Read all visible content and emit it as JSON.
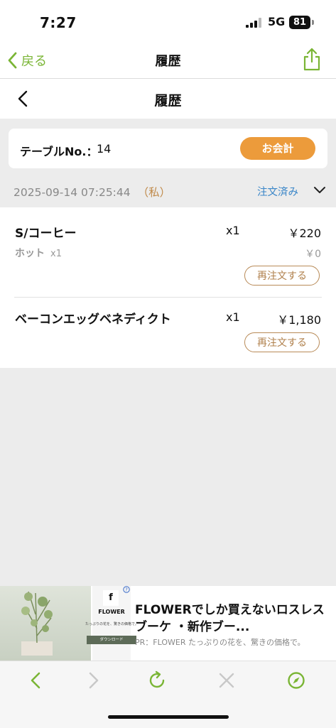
{
  "status_bar": {
    "time": "7:27",
    "network": "5G",
    "battery": "81"
  },
  "browser_nav": {
    "back_label": "戻る",
    "title": "履歴"
  },
  "page_header": {
    "title": "履歴"
  },
  "table_info": {
    "label": "テーブルNo.：",
    "number": "14",
    "pay_button": "お会計"
  },
  "order": {
    "datetime": "2025-09-14 07:25:44",
    "owner": "（私）",
    "status": "注文済み",
    "items": [
      {
        "name": "S/コーヒー",
        "qty": "x1",
        "price": "￥220",
        "option": {
          "name": "ホット",
          "qty": "x1",
          "price": "￥0"
        },
        "reorder_label": "再注文する"
      },
      {
        "name": "ベーコンエッグベネディクト",
        "qty": "x1",
        "price": "￥1,180",
        "reorder_label": "再注文する"
      }
    ]
  },
  "ad": {
    "brand": "FLOWER",
    "title": "FLOWERでしか買えないロスレスブーケ ・新作ブー...",
    "subtitle": "PR：FLOWER たっぷりの花を、驚きの価格で。",
    "logo_caption": "たっぷりの花を、驚きの価格で。",
    "download_label": "ダウンロード"
  },
  "colors": {
    "accent_green": "#7ab535",
    "pay_orange": "#ec9b3b",
    "status_blue": "#3a86c8",
    "reorder_brown": "#b0804c"
  },
  "icons": [
    "chevron-left-icon",
    "share-icon",
    "chevron-down-icon",
    "info-icon",
    "reload-icon",
    "close-icon",
    "compass-icon"
  ]
}
